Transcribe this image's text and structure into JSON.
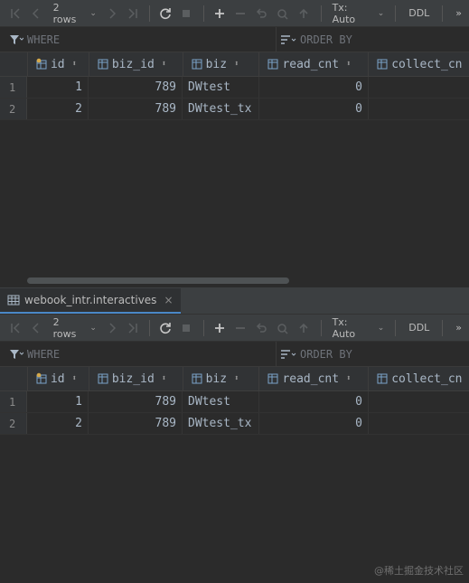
{
  "toolbar": {
    "rows_label": "2 rows",
    "tx_label": "Tx: Auto",
    "ddl_label": "DDL",
    "more_label": "»"
  },
  "filter": {
    "where_label": "WHERE",
    "orderby_label": "ORDER BY"
  },
  "columns": [
    {
      "name": "id",
      "key": true
    },
    {
      "name": "biz_id"
    },
    {
      "name": "biz"
    },
    {
      "name": "read_cnt"
    },
    {
      "name": "collect_cn"
    }
  ],
  "rows": [
    {
      "num": "1",
      "id": "1",
      "biz_id": "789",
      "biz": "DWtest",
      "read_cnt": "0",
      "collect_cnt": ""
    },
    {
      "num": "2",
      "id": "2",
      "biz_id": "789",
      "biz": "DWtest_tx",
      "read_cnt": "0",
      "collect_cnt": ""
    }
  ],
  "tab": {
    "title": "webook_intr.interactives",
    "close": "×"
  },
  "watermark": "@稀土掘金技术社区",
  "colors": {
    "background": "#2b2b2b",
    "toolbar": "#3c3f41",
    "text": "#a9b7c6",
    "accent": "#4a88c7"
  }
}
